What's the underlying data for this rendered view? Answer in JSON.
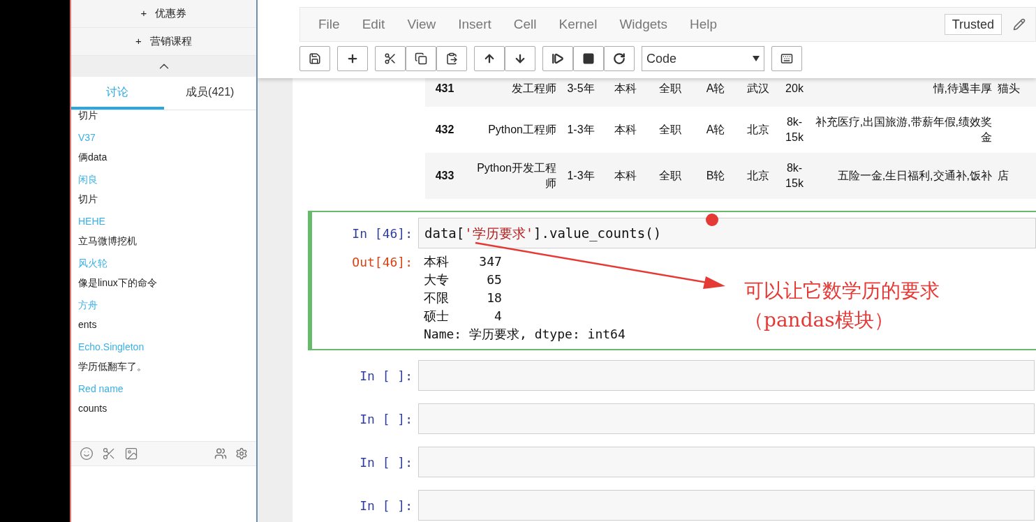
{
  "sidebar": {
    "actions": [
      {
        "icon": "+",
        "label": "优惠券"
      },
      {
        "icon": "+",
        "label": "营销课程"
      }
    ],
    "tabs": [
      {
        "label": "讨论",
        "selected": true
      },
      {
        "label": "成员(421)",
        "selected": false
      }
    ],
    "messages": [
      {
        "kind": "text",
        "text": "切片"
      },
      {
        "kind": "name",
        "text": "V37"
      },
      {
        "kind": "text",
        "text": "俩data"
      },
      {
        "kind": "name",
        "text": "闲良"
      },
      {
        "kind": "text",
        "text": "切片"
      },
      {
        "kind": "name",
        "text": "HEHE"
      },
      {
        "kind": "text",
        "text": "立马微博挖机"
      },
      {
        "kind": "name",
        "text": "风火轮"
      },
      {
        "kind": "text",
        "text": "像是linux下的命令"
      },
      {
        "kind": "name",
        "text": "方舟"
      },
      {
        "kind": "text",
        "text": "ents"
      },
      {
        "kind": "name",
        "text": "Echo.Singleton"
      },
      {
        "kind": "text",
        "text": "学历低翻车了。"
      },
      {
        "kind": "name",
        "text": "Red name"
      },
      {
        "kind": "text",
        "text": "counts"
      }
    ]
  },
  "notebook": {
    "menu": [
      "File",
      "Edit",
      "View",
      "Insert",
      "Cell",
      "Kernel",
      "Widgets",
      "Help"
    ],
    "trusted": "Trusted",
    "cell_type": "Code",
    "table": {
      "rows": [
        {
          "cells": [
            "431",
            "发工程师",
            "3-5年",
            "本科",
            "全职",
            "A轮",
            "武汉",
            "20k",
            "情,待遇丰厚",
            "猫头"
          ]
        },
        {
          "cells": [
            "432",
            "Python工程师",
            "1-3年",
            "本科",
            "全职",
            "A轮",
            "北京",
            "8k-15k",
            "补充医疗,出国旅游,带薪年假,绩效奖金",
            ""
          ]
        },
        {
          "cells": [
            "433",
            "Python开发工程师",
            "1-3年",
            "本科",
            "全职",
            "B轮",
            "北京",
            "8k-15k",
            "五险一金,生日福利,交通补,饭补",
            "店"
          ]
        }
      ]
    },
    "cells": [
      {
        "selected": true,
        "prompt": "In [46]:",
        "code": [
          {
            "kind": "plain",
            "text": "data["
          },
          {
            "kind": "string",
            "text": "'学历要求'"
          },
          {
            "kind": "plain",
            "text": "].value_counts()"
          }
        ],
        "out_prompt": "Out[46]:",
        "output": [
          "本科    347",
          "大专     65",
          "不限     18",
          "硕士      4",
          "Name: 学历要求, dtype: int64"
        ]
      },
      {
        "selected": false,
        "prompt": "In [ ]:"
      },
      {
        "selected": false,
        "prompt": "In [ ]:"
      },
      {
        "selected": false,
        "prompt": "In [ ]:"
      },
      {
        "selected": false,
        "prompt": "In [ ]:"
      }
    ],
    "annotation": [
      "可以让它数学历的要求",
      "（pandas模块）"
    ]
  }
}
